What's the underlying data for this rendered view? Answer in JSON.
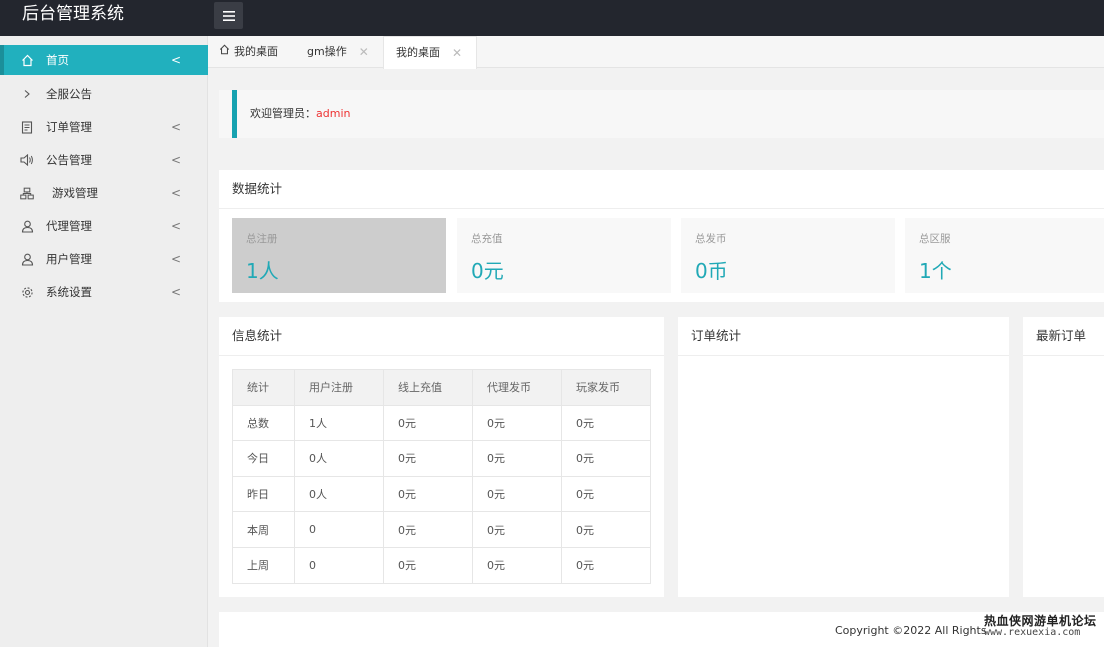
{
  "header": {
    "logo": "后台管理系统",
    "menu_icon": "hamburger-icon"
  },
  "sidebar": {
    "items": [
      {
        "label": "首页",
        "icon": "home-icon",
        "arrow": "<",
        "active": true
      },
      {
        "label": "全服公告",
        "icon": "chevron-right-icon"
      },
      {
        "label": "订单管理",
        "icon": "document-icon",
        "arrow": "<"
      },
      {
        "label": "公告管理",
        "icon": "speaker-icon",
        "arrow": "<"
      },
      {
        "label": "游戏管理",
        "icon": "sitemap-icon",
        "arrow": "<"
      },
      {
        "label": "代理管理",
        "icon": "user-icon",
        "arrow": "<"
      },
      {
        "label": "用户管理",
        "icon": "user-icon",
        "arrow": "<"
      },
      {
        "label": "系统设置",
        "icon": "gear-icon",
        "arrow": "<"
      }
    ]
  },
  "tabs": [
    {
      "label": "我的桌面",
      "icon": "home-icon"
    },
    {
      "label": "gm操作",
      "close": "✕"
    },
    {
      "label": "我的桌面",
      "close": "✕",
      "active": true
    }
  ],
  "welcome": {
    "prefix": "欢迎管理员：",
    "user": "admin"
  },
  "stats": {
    "title": "数据统计",
    "items": [
      {
        "label": "总注册",
        "value": "1人"
      },
      {
        "label": "总充值",
        "value": "0元"
      },
      {
        "label": "总发币",
        "value": "0币"
      },
      {
        "label": "总区服",
        "value": "1个"
      }
    ]
  },
  "info": {
    "title": "信息统计",
    "headers": [
      "统计",
      "用户注册",
      "线上充值",
      "代理发币",
      "玩家发币"
    ],
    "rows": [
      [
        "总数",
        "1人",
        "0元",
        "0元",
        "0元"
      ],
      [
        "今日",
        "0人",
        "0元",
        "0元",
        "0元"
      ],
      [
        "昨日",
        "0人",
        "0元",
        "0元",
        "0元"
      ],
      [
        "本周",
        "0",
        "0元",
        "0元",
        "0元"
      ],
      [
        "上周",
        "0",
        "0元",
        "0元",
        "0元"
      ]
    ]
  },
  "orders": {
    "title": "订单统计"
  },
  "latest": {
    "title": "最新订单"
  },
  "footer": {
    "copyright": "Copyright ©2022 All Rights"
  },
  "watermark": {
    "line1": "热血侠网游单机论坛",
    "line2": "www.rexuexia.com"
  },
  "colors": {
    "accent": "#21b0be",
    "header": "#23262e",
    "admin": "#e33333"
  }
}
